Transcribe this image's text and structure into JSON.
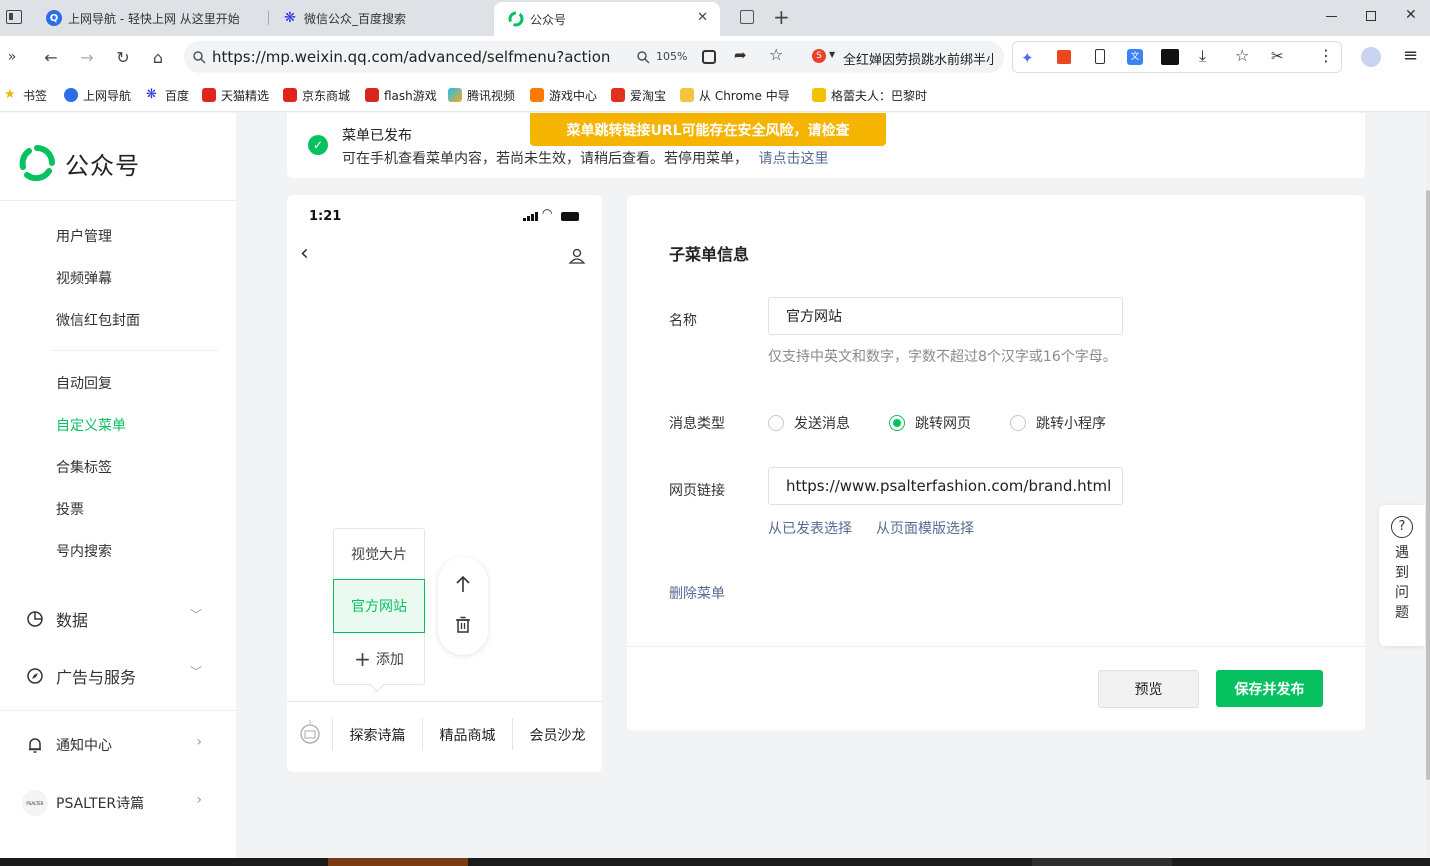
{
  "browser": {
    "tabs": [
      {
        "title": "上网导航 - 轻快上网 从这里开始"
      },
      {
        "title": "微信公众_百度搜索"
      },
      {
        "title": "公众号"
      }
    ],
    "url": "https://mp.weixin.qq.com/advanced/selfmenu?action=in",
    "zoom": "105%",
    "search_suggestion": "全红婵因劳损跳水前绑半小",
    "bookmarks": [
      "书签",
      "上网导航",
      "百度",
      "天猫精选",
      "京东商城",
      "flash游戏",
      "腾讯视频",
      "游戏中心",
      "爱淘宝",
      "从 Chrome 中导",
      "格蕾夫人：巴黎时"
    ]
  },
  "sidebar": {
    "logo_text": "公众号",
    "items_group1": [
      "用户管理",
      "视频弹幕",
      "微信红包封面"
    ],
    "items_group2": [
      "自动回复",
      "自定义菜单",
      "合集标签",
      "投票",
      "号内搜索"
    ],
    "active_item": "自定义菜单",
    "data_label": "数据",
    "ads_label": "广告与服务",
    "notify_label": "通知中心",
    "account_name": "PSALTER诗篇",
    "account_avatar_text": "PSALTER"
  },
  "notice": {
    "title": "菜单已发布",
    "desc": "可在手机查看菜单内容，若尚未生效，请稍后查看。若停用菜单，",
    "link": "请点击这里",
    "warning": "菜单跳转链接URL可能存在安全风险，请检查"
  },
  "phone": {
    "time": "1:21",
    "submenu": [
      "视觉大片",
      "官方网站"
    ],
    "add_label": "添加",
    "bottom_menu": [
      "探索诗篇",
      "精品商城",
      "会员沙龙"
    ]
  },
  "form": {
    "section_title": "子菜单信息",
    "name_label": "名称",
    "name_value": "官方网站",
    "name_hint": "仅支持中英文和数字，字数不超过8个汉字或16个字母。",
    "type_label": "消息类型",
    "type_options": [
      "发送消息",
      "跳转网页",
      "跳转小程序"
    ],
    "type_selected": "跳转网页",
    "url_label": "网页链接",
    "url_value": "https://www.psalterfashion.com/brand.html",
    "select_published": "从已发表选择",
    "select_template": "从页面模版选择",
    "delete_label": "删除菜单",
    "preview_label": "预览",
    "save_label": "保存并发布"
  },
  "help": {
    "chars": [
      "遇",
      "到",
      "问",
      "题"
    ]
  },
  "colors": {
    "accent": "#07c160",
    "warning": "#f5b400",
    "link": "#576b95"
  }
}
